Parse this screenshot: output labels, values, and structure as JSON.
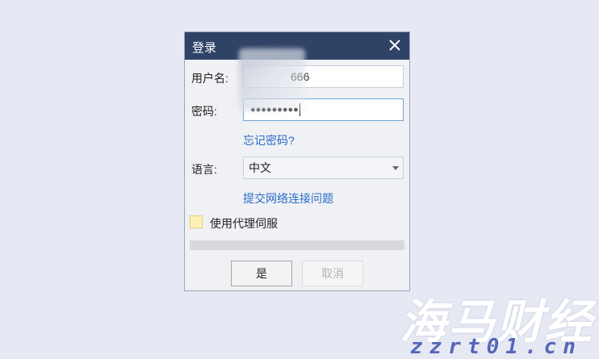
{
  "dialog": {
    "title": "登录",
    "close_icon": "close-icon",
    "username_label": "用户名:",
    "username_value": "666",
    "password_label": "密码:",
    "password_value": "●●●●●●●●●",
    "forgot_link": "忘记密码?",
    "language_label": "语言:",
    "language_value": "中文",
    "network_link": "提交网络连接问题",
    "proxy_label": "使用代理伺服",
    "proxy_checked": false,
    "progress": 0,
    "ok_label": "是",
    "cancel_label": "取消"
  },
  "watermark": {
    "chinese": "海马财经",
    "url": "zzrt01.cn"
  },
  "colors": {
    "titlebar": "#2f4366",
    "link": "#2a6bc6",
    "background": "#e6e9f3"
  }
}
